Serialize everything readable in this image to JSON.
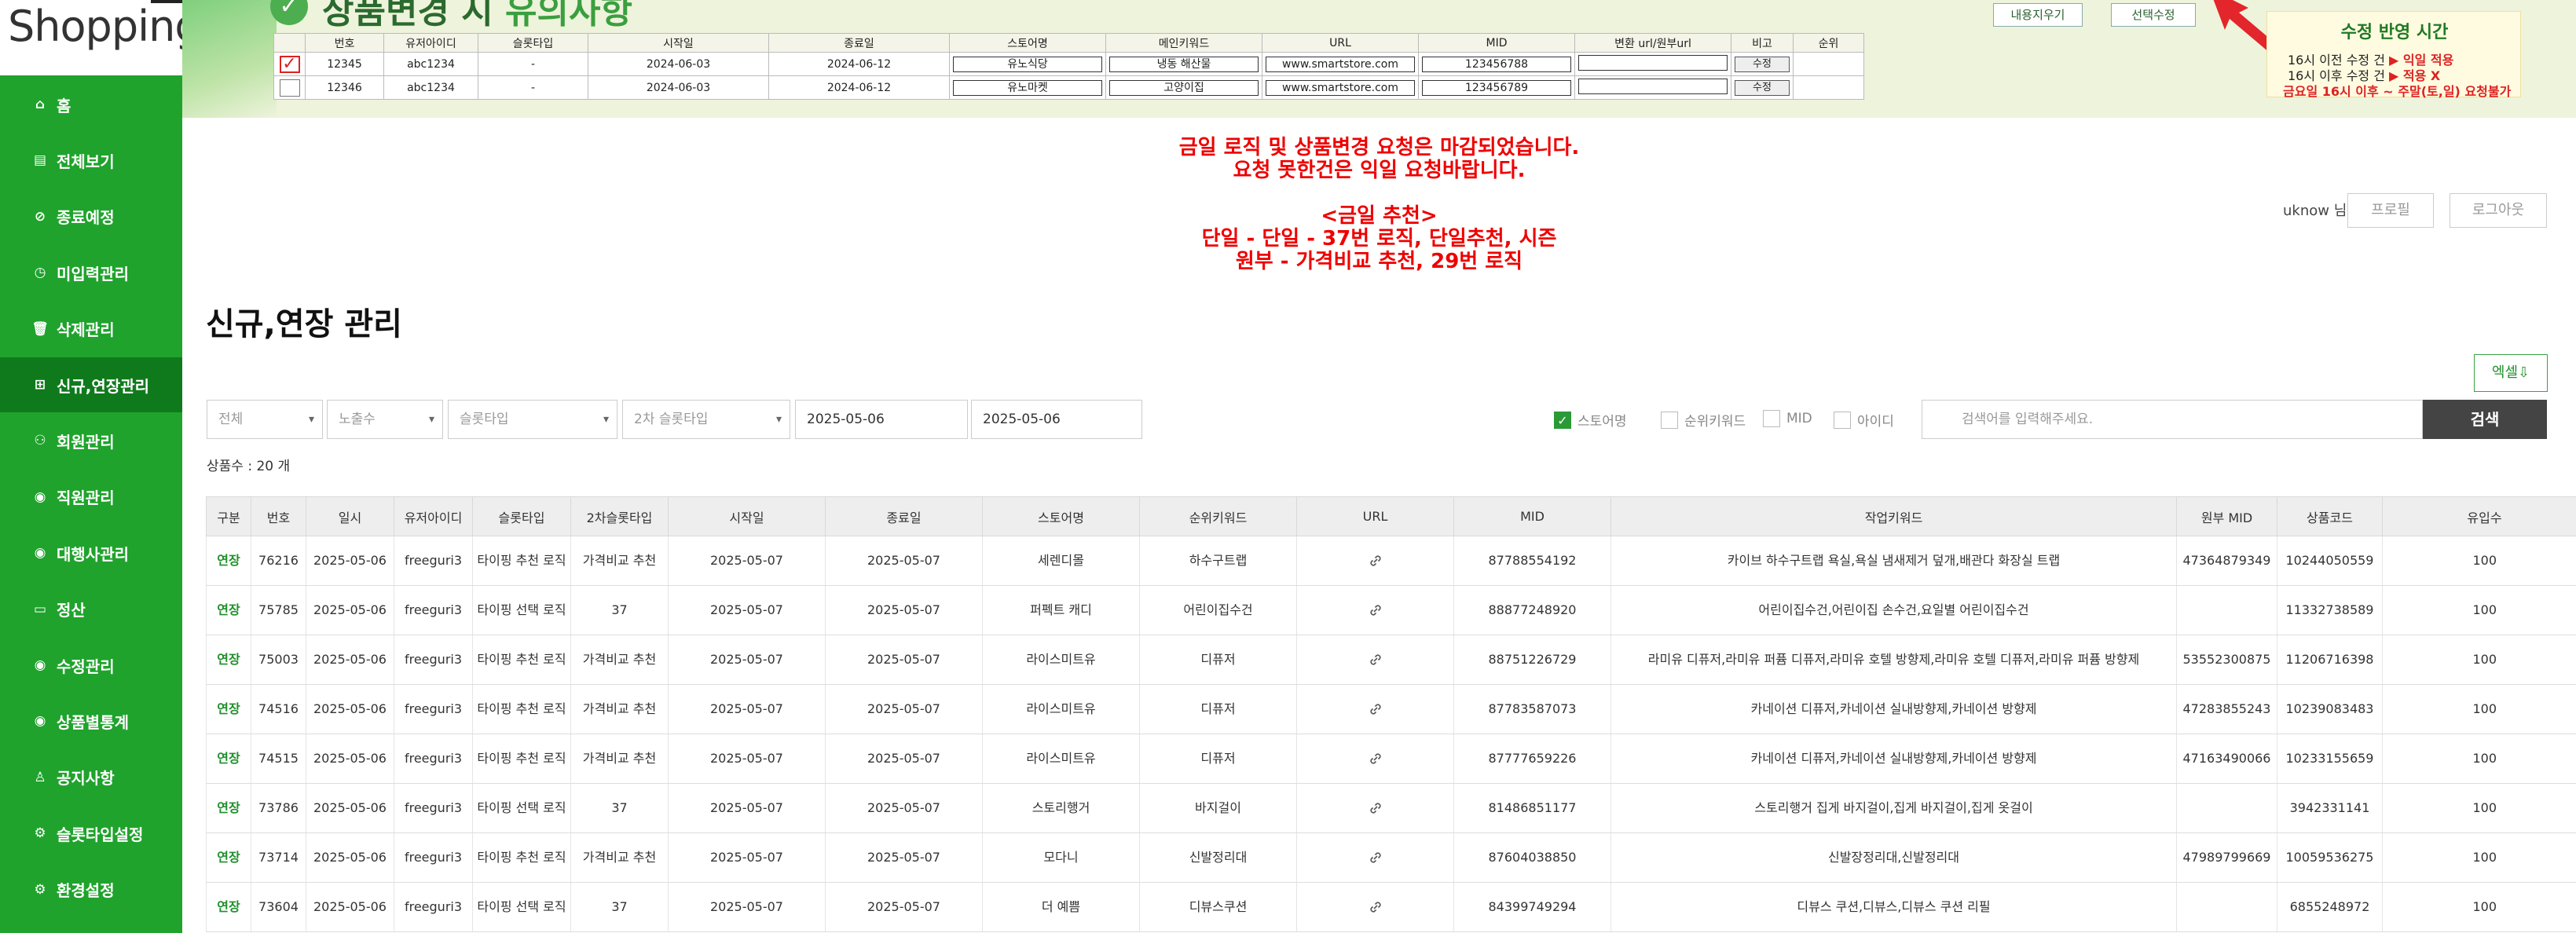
{
  "app": {
    "logo": "Shopping"
  },
  "sidebar": {
    "items": [
      {
        "label": "홈",
        "icon": "home-icon",
        "glyph": "⌂"
      },
      {
        "label": "전체보기",
        "icon": "document-icon",
        "glyph": "▤"
      },
      {
        "label": "종료예정",
        "icon": "ban-icon",
        "glyph": "⊘"
      },
      {
        "label": "미입력관리",
        "icon": "clock-icon",
        "glyph": "◷"
      },
      {
        "label": "삭제관리",
        "icon": "trash-icon",
        "glyph": "🗑"
      },
      {
        "label": "신규,연장관리",
        "icon": "plus-square-icon",
        "glyph": "⊞"
      },
      {
        "label": "회원관리",
        "icon": "users-icon",
        "glyph": "⚇"
      },
      {
        "label": "직원관리",
        "icon": "user-circle-icon",
        "glyph": "◉"
      },
      {
        "label": "대행사관리",
        "icon": "user-circle-icon",
        "glyph": "◉"
      },
      {
        "label": "정산",
        "icon": "card-icon",
        "glyph": "▭"
      },
      {
        "label": "수정관리",
        "icon": "user-circle-icon",
        "glyph": "◉"
      },
      {
        "label": "상품별통계",
        "icon": "user-circle-icon",
        "glyph": "◉"
      },
      {
        "label": "공지사항",
        "icon": "user-icon",
        "glyph": "♙"
      },
      {
        "label": "슬롯타입설정",
        "icon": "gear-icon",
        "glyph": "⚙"
      },
      {
        "label": "환경설정",
        "icon": "gear-icon",
        "glyph": "⚙"
      }
    ],
    "active_index": 5
  },
  "banner": {
    "title_prefix": "상품변경 시 ",
    "title_highlight": "유의사항",
    "button_clear": "내용지우기",
    "button_apply": "선택수정",
    "example_headers": [
      "",
      "번호",
      "유저아이디",
      "슬롯타입",
      "시작일",
      "종료일",
      "스토어명",
      "메인키워드",
      "URL",
      "MID",
      "변환 url/원부url",
      "비고",
      "순위"
    ],
    "example_rows": [
      {
        "checked": true,
        "no": "12345",
        "user": "abc1234",
        "slot": "-",
        "start": "2024-06-03",
        "end": "2024-06-12",
        "store": "유노식당",
        "keyword": "냉동 해산물",
        "url": "www.smartstore.com",
        "mid": "123456788",
        "conv": "",
        "note": "수정",
        "rank": ""
      },
      {
        "checked": false,
        "no": "12346",
        "user": "abc1234",
        "slot": "-",
        "start": "2024-06-03",
        "end": "2024-06-12",
        "store": "유노마켓",
        "keyword": "고양이집",
        "url": "www.smartstore.com",
        "mid": "123456789",
        "conv": "",
        "note": "수정",
        "rank": ""
      }
    ],
    "notice": {
      "title": "수정 반영 시간",
      "line1_text": "16시 이전 수정 건",
      "line1_result": "▶ 익일 적용",
      "line2_text": "16시 이후 수정 건",
      "line2_result": "▶ 적용 X",
      "line3": "금요일 16시 이후 ~ 주말(토,일) 요청불가"
    }
  },
  "announcement": {
    "line1": "금일 로직 및 상품변경 요청은 마감되었습니다.",
    "line2": "요청 못한건은 익일 요청바랍니다.",
    "line3": "",
    "line4": "<금일 추천>",
    "line5": "단일 - 단일 - 37번 로직, 단일추천, 시즌",
    "line6": "원부 - 가격비교 추천, 29번 로직"
  },
  "user": {
    "name": "uknow 님",
    "profile_label": "프로필",
    "logout_label": "로그아웃"
  },
  "page": {
    "title": "신규,연장 관리",
    "excel_label": "엑셀⇩"
  },
  "filters": {
    "category": "전체",
    "exposure": "노출수",
    "slot_type": "슬롯타입",
    "slot_type2": "2차 슬롯타입",
    "date_from": "2025-05-06",
    "date_to": "2025-05-06",
    "checkboxes": [
      {
        "label": "스토어명",
        "checked": true
      },
      {
        "label": "순위키워드",
        "checked": false
      },
      {
        "label": "MID",
        "checked": false
      },
      {
        "label": "아이디",
        "checked": false
      }
    ],
    "search_placeholder": "검색어를 입력해주세요.",
    "search_label": "검색"
  },
  "summary": {
    "count_label": "상품수 : 20 개"
  },
  "table": {
    "headers": [
      "구분",
      "번호",
      "일시",
      "유저아이디",
      "슬롯타입",
      "2차슬롯타입",
      "시작일",
      "종료일",
      "스토어명",
      "순위키워드",
      "URL",
      "MID",
      "작업키워드",
      "원부 MID",
      "상품코드",
      "유입수"
    ],
    "rows": [
      {
        "kind": "연장",
        "no": "76216",
        "date": "2025-05-06",
        "user": "freeguri3",
        "slot": "타이핑 추천 로직",
        "slot2": "가격비교 추천",
        "start": "2025-05-07",
        "end": "2025-05-07",
        "store": "세렌디몰",
        "rank_kw": "하수구트랩",
        "mid": "87788554192",
        "work_kw": "카이브 하수구트랩 욕실,욕실 냄새제거 덮개,배관다 화장실 트랩",
        "parent_mid": "47364879349",
        "code": "10244050559",
        "inflow": "100"
      },
      {
        "kind": "연장",
        "no": "75785",
        "date": "2025-05-06",
        "user": "freeguri3",
        "slot": "타이핑 선택 로직",
        "slot2": "37",
        "start": "2025-05-07",
        "end": "2025-05-07",
        "store": "퍼펙트 캐디",
        "rank_kw": "어린이집수건",
        "mid": "88877248920",
        "work_kw": "어린이집수건,어린이집 손수건,요일별 어린이집수건",
        "parent_mid": "",
        "code": "11332738589",
        "inflow": "100"
      },
      {
        "kind": "연장",
        "no": "75003",
        "date": "2025-05-06",
        "user": "freeguri3",
        "slot": "타이핑 추천 로직",
        "slot2": "가격비교 추천",
        "start": "2025-05-07",
        "end": "2025-05-07",
        "store": "라이스미트유",
        "rank_kw": "디퓨저",
        "mid": "88751226729",
        "work_kw": "라미유 디퓨저,라미유 퍼퓸 디퓨저,라미유 호텔 방향제,라미유 호텔 디퓨저,라미유 퍼퓸 방향제",
        "parent_mid": "53552300875",
        "code": "11206716398",
        "inflow": "100"
      },
      {
        "kind": "연장",
        "no": "74516",
        "date": "2025-05-06",
        "user": "freeguri3",
        "slot": "타이핑 추천 로직",
        "slot2": "가격비교 추천",
        "start": "2025-05-07",
        "end": "2025-05-07",
        "store": "라이스미트유",
        "rank_kw": "디퓨저",
        "mid": "87783587073",
        "work_kw": "카네이션 디퓨저,카네이션 실내방향제,카네이션 방향제",
        "parent_mid": "47283855243",
        "code": "10239083483",
        "inflow": "100"
      },
      {
        "kind": "연장",
        "no": "74515",
        "date": "2025-05-06",
        "user": "freeguri3",
        "slot": "타이핑 추천 로직",
        "slot2": "가격비교 추천",
        "start": "2025-05-07",
        "end": "2025-05-07",
        "store": "라이스미트유",
        "rank_kw": "디퓨저",
        "mid": "87777659226",
        "work_kw": "카네이션 디퓨저,카네이션 실내방향제,카네이션 방향제",
        "parent_mid": "47163490066",
        "code": "10233155659",
        "inflow": "100"
      },
      {
        "kind": "연장",
        "no": "73786",
        "date": "2025-05-06",
        "user": "freeguri3",
        "slot": "타이핑 선택 로직",
        "slot2": "37",
        "start": "2025-05-07",
        "end": "2025-05-07",
        "store": "스토리행거",
        "rank_kw": "바지걸이",
        "mid": "81486851177",
        "work_kw": "스토리행거 집게 바지걸이,집게 바지걸이,집게 옷걸이",
        "parent_mid": "",
        "code": "3942331141",
        "inflow": "100"
      },
      {
        "kind": "연장",
        "no": "73714",
        "date": "2025-05-06",
        "user": "freeguri3",
        "slot": "타이핑 추천 로직",
        "slot2": "가격비교 추천",
        "start": "2025-05-07",
        "end": "2025-05-07",
        "store": "모다니",
        "rank_kw": "신발정리대",
        "mid": "87604038850",
        "work_kw": "신발장정리대,신발정리대",
        "parent_mid": "47989799669",
        "code": "10059536275",
        "inflow": "100"
      },
      {
        "kind": "연장",
        "no": "73604",
        "date": "2025-05-06",
        "user": "freeguri3",
        "slot": "타이핑 선택 로직",
        "slot2": "37",
        "start": "2025-05-07",
        "end": "2025-05-07",
        "store": "더 예쁨",
        "rank_kw": "디뷰스쿠션",
        "mid": "84399749294",
        "work_kw": "디뷰스 쿠션,디뷰스,디뷰스 쿠션 리필",
        "parent_mid": "",
        "code": "6855248972",
        "inflow": "100"
      }
    ]
  }
}
